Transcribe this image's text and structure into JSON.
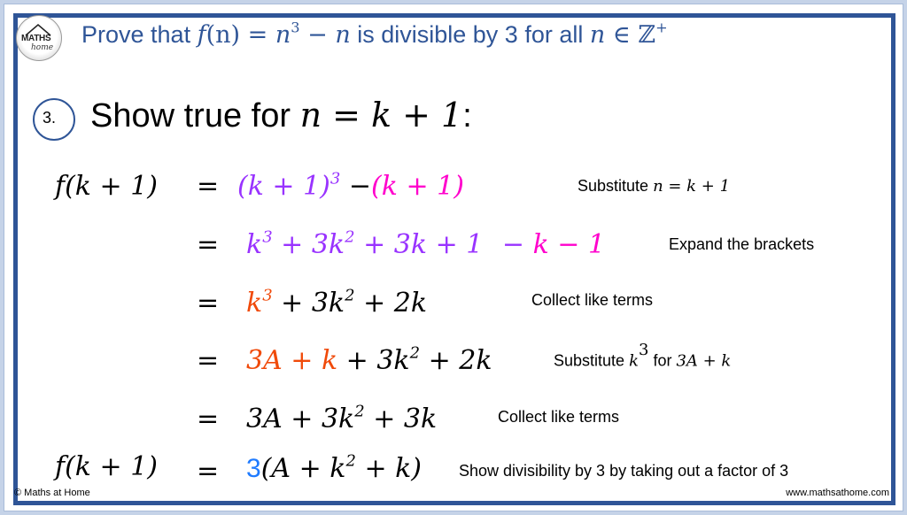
{
  "logo": {
    "line1": "MATHS",
    "line2": "home"
  },
  "title": {
    "prefix": "Prove that ",
    "func": "f",
    "arg": "(n)",
    "eq": " = ",
    "n": "n",
    "exp": "3",
    "minus": " − ",
    "n2": "n",
    "mid": " is divisible by 3 for all ",
    "n3": "n",
    "in": " ∈ ",
    "set": "ℤ",
    "setsup": "+"
  },
  "step": {
    "number": "3.",
    "label": "Show true for ",
    "eq": "n = k + 1",
    "colon": ":"
  },
  "rows": [
    {
      "lhs": "f(k + 1)",
      "eq": "=",
      "parts": [
        {
          "t": "(k + 1)",
          "c": "purple"
        },
        {
          "sup": "3",
          "c": "purple"
        },
        {
          "t": " −",
          "c": "black"
        },
        {
          "t": "(k + 1)",
          "c": "magenta"
        }
      ],
      "note": "Substitute ",
      "note_math": "n = k + 1"
    },
    {
      "lhs": "",
      "eq": "=",
      "note": "Expand the brackets"
    },
    {
      "lhs": "",
      "eq": "=",
      "note": "Collect like terms"
    },
    {
      "lhs": "",
      "eq": "=",
      "note": "Substitute ",
      "note_math1": "k",
      "note_sup": "3",
      "note_mid": " for ",
      "note_math2": "3A + k"
    },
    {
      "lhs": "",
      "eq": "=",
      "note": "Collect like terms"
    },
    {
      "lhs": "f(k + 1)",
      "eq": "=",
      "note": "Show divisibility by 3 by taking out a factor of 3"
    }
  ],
  "expr": {
    "r1": {
      "a": "(k + 1)",
      "a_sup": "3",
      "minus": " −",
      "b": "(k + 1)"
    },
    "r2": {
      "a": "k",
      "a_sup": "3",
      "b": " + 3k",
      "b_sup": "2",
      "c": " + 3k + 1",
      "d": " −",
      "e": " k − 1"
    },
    "r3": {
      "a": "k",
      "a_sup": "3",
      "b": " + 3k",
      "b_sup": "2",
      "c": " + 2k"
    },
    "r4": {
      "a": "3A + k",
      "b": " + 3k",
      "b_sup": "2",
      "c": " + 2k"
    },
    "r5": {
      "a": "3A + 3k",
      "a_sup": "2",
      "b": " + 3k"
    },
    "r6": {
      "a": "3",
      "b": "(A + k",
      "b_sup": "2",
      "c": " + k)"
    }
  },
  "footer": {
    "left": "© Maths at Home",
    "right": "www.mathsathome.com"
  },
  "colors": {
    "title_blue": "#2f5597",
    "purple": "#9933ff",
    "magenta": "#ff00cc",
    "orange_red": "#f04a0a",
    "blue": "#1f7bff"
  }
}
